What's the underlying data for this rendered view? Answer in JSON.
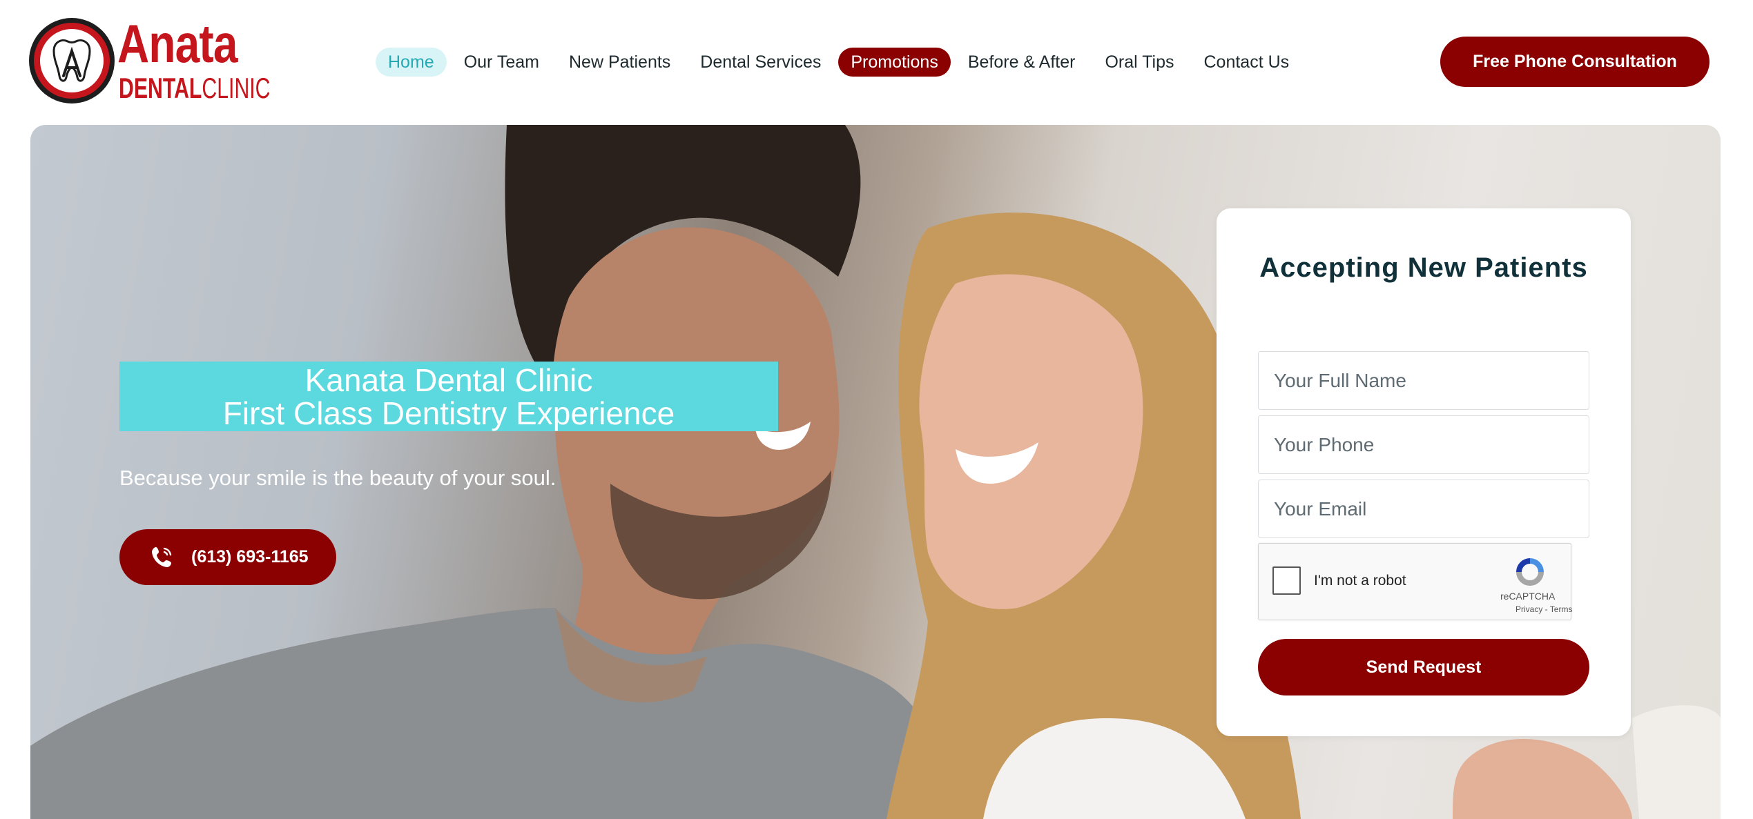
{
  "logo": {
    "word1": "Anata",
    "word2_bold": "DENTAL",
    "word2_thin": "CLINIC"
  },
  "nav": {
    "items": [
      {
        "label": "Home"
      },
      {
        "label": "Our Team"
      },
      {
        "label": "New Patients"
      },
      {
        "label": "Dental Services"
      },
      {
        "label": "Promotions"
      },
      {
        "label": "Before & After"
      },
      {
        "label": "Oral Tips"
      },
      {
        "label": "Contact Us"
      }
    ],
    "cta_label": "Free Phone Consultation"
  },
  "hero": {
    "title_line1": "Kanata Dental Clinic",
    "title_line2": "First Class Dentistry Experience",
    "subtitle": "Because your smile is the beauty of your soul.",
    "phone": "(613) 693-1165"
  },
  "form": {
    "title": "Accepting New Patients",
    "name_placeholder": "Your Full Name",
    "phone_placeholder": "Your Phone",
    "email_placeholder": "Your Email",
    "captcha_label": "I'm not a robot",
    "captcha_brand": "reCAPTCHA",
    "captcha_links": "Privacy - Terms",
    "submit_label": "Send Request"
  },
  "colors": {
    "brand_red": "#8b0000",
    "logo_red": "#c4161c",
    "teal": "#5cd8df",
    "nav_active_bg": "#d9f4f6",
    "nav_active_text": "#27a9b3"
  }
}
